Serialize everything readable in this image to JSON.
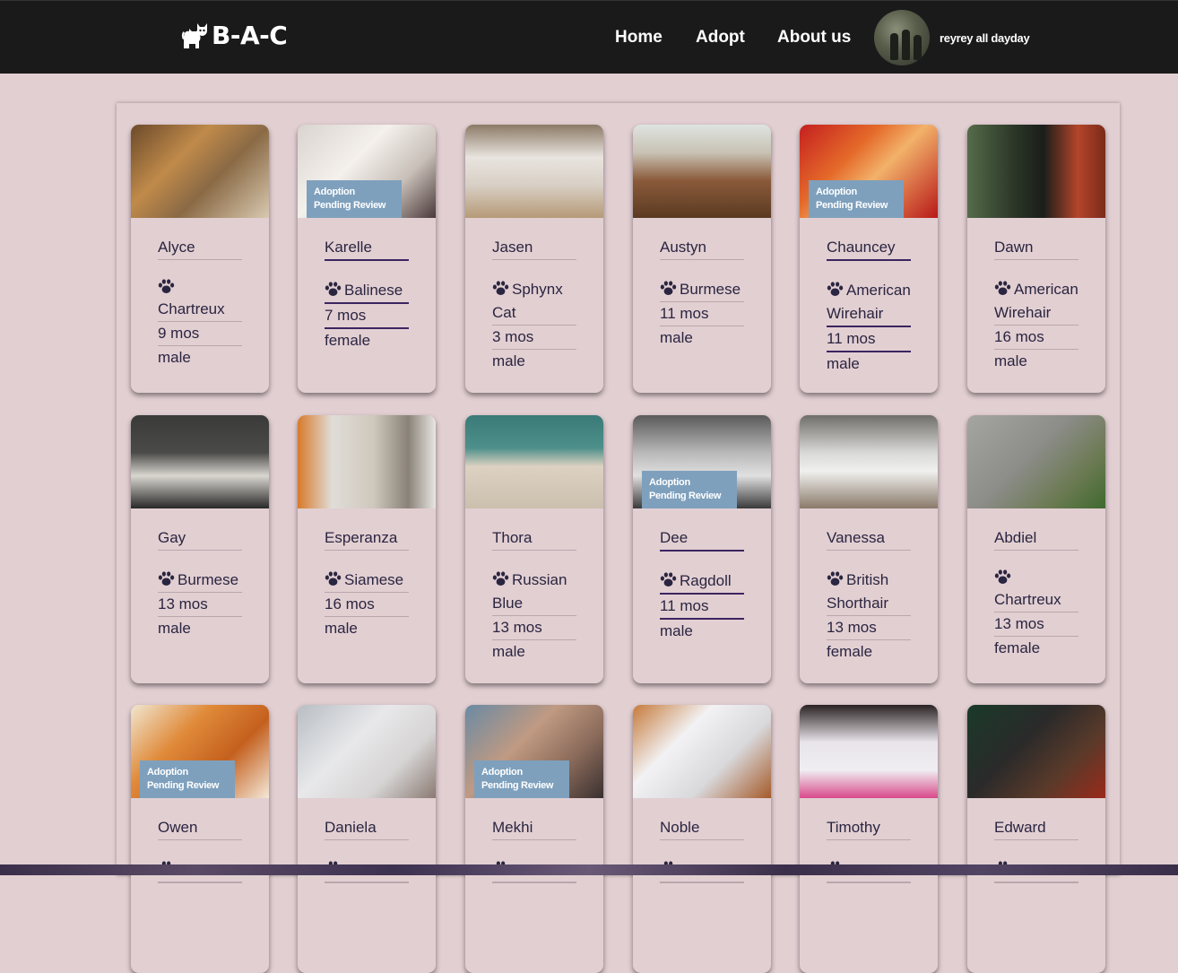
{
  "brand": {
    "text": "B-A-C",
    "logo_icon": "cat-logo-icon"
  },
  "nav": {
    "home": "Home",
    "adopt": "Adopt",
    "about": "About us"
  },
  "user": {
    "name": "reyrey all dayday"
  },
  "badge": {
    "line1": "Adoption",
    "line2": "Pending Review"
  },
  "cats": [
    {
      "name": "Alyce",
      "breed": "Chartreux",
      "age": "9 mos",
      "sex": "male",
      "pending": false
    },
    {
      "name": "Karelle",
      "breed": "Balinese",
      "age": "7 mos",
      "sex": "female",
      "pending": true
    },
    {
      "name": "Jasen",
      "breed": "Sphynx Cat",
      "age": "3 mos",
      "sex": "male",
      "pending": false
    },
    {
      "name": "Austyn",
      "breed": "Burmese",
      "age": "11 mos",
      "sex": "male",
      "pending": false
    },
    {
      "name": "Chauncey",
      "breed": "American Wirehair",
      "age": "11 mos",
      "sex": "male",
      "pending": true
    },
    {
      "name": "Dawn",
      "breed": "American Wirehair",
      "age": "16 mos",
      "sex": "male",
      "pending": false
    },
    {
      "name": "Gay",
      "breed": "Burmese",
      "age": "13 mos",
      "sex": "male",
      "pending": false
    },
    {
      "name": "Esperanza",
      "breed": "Siamese",
      "age": "16 mos",
      "sex": "male",
      "pending": false
    },
    {
      "name": "Thora",
      "breed": "Russian Blue",
      "age": "13 mos",
      "sex": "male",
      "pending": false
    },
    {
      "name": "Dee",
      "breed": "Ragdoll",
      "age": "11 mos",
      "sex": "male",
      "pending": true
    },
    {
      "name": "Vanessa",
      "breed": "British Shorthair",
      "age": "13 mos",
      "sex": "female",
      "pending": false
    },
    {
      "name": "Abdiel",
      "breed": "Chartreux",
      "age": "13 mos",
      "sex": "female",
      "pending": false
    },
    {
      "name": "Owen",
      "breed": "",
      "age": "",
      "sex": "",
      "pending": true
    },
    {
      "name": "Daniela",
      "breed": "",
      "age": "",
      "sex": "",
      "pending": false
    },
    {
      "name": "Mekhi",
      "breed": "",
      "age": "",
      "sex": "",
      "pending": true
    },
    {
      "name": "Noble",
      "breed": "",
      "age": "",
      "sex": "",
      "pending": false
    },
    {
      "name": "Timothy",
      "breed": "",
      "age": "",
      "sex": "",
      "pending": false
    },
    {
      "name": "Edward",
      "breed": "",
      "age": "",
      "sex": "",
      "pending": false
    }
  ],
  "colors": {
    "nav_bg": "#1b1a1b",
    "page_bg": "#e2cfd2",
    "badge_bg": "#7ea0bd",
    "text": "#2a2540",
    "underline_hl": "#3b2560"
  }
}
